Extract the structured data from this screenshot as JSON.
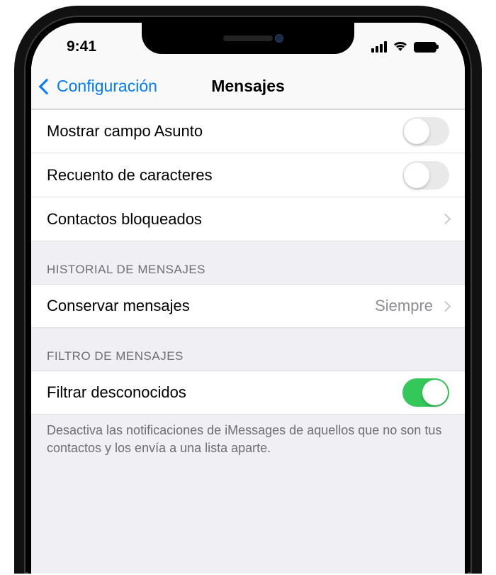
{
  "status": {
    "time": "9:41"
  },
  "nav": {
    "back_label": "Configuración",
    "title": "Mensajes"
  },
  "group1": {
    "subject_field": {
      "label": "Mostrar campo Asunto",
      "on": false
    },
    "char_count": {
      "label": "Recuento de caracteres",
      "on": false
    },
    "blocked": {
      "label": "Contactos bloqueados"
    }
  },
  "history": {
    "header": "HISTORIAL DE MENSAJES",
    "keep": {
      "label": "Conservar mensajes",
      "value": "Siempre"
    }
  },
  "filter": {
    "header": "FILTRO DE MENSAJES",
    "filter_unknown": {
      "label": "Filtrar desconocidos",
      "on": true
    },
    "footer": "Desactiva las notificaciones de iMessages de aquellos que no son tus contactos y los envía a una lista aparte."
  }
}
